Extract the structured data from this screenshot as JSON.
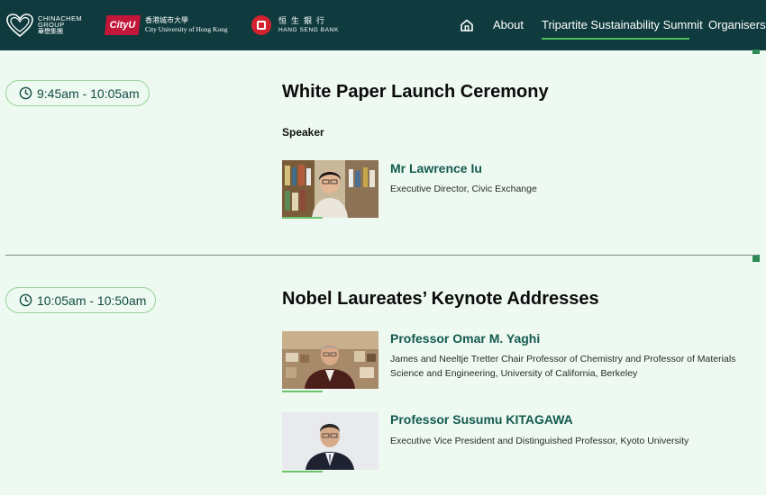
{
  "header": {
    "logos": {
      "chinachem": {
        "line1": "CHINACHEM",
        "line2": "GROUP",
        "line3": "華懋集團"
      },
      "cityu": {
        "badge": "CityU",
        "line1": "香港城市大學",
        "line2": "City University of Hong Kong"
      },
      "hangseng": {
        "line1": "恒生銀行",
        "line2": "HANG SENG BANK"
      }
    },
    "nav": {
      "home_icon": "home-icon",
      "items": [
        {
          "label": "About"
        },
        {
          "label": "Tripartite Sustainability Summit",
          "active": true
        },
        {
          "label": "Organisers"
        }
      ]
    }
  },
  "colors": {
    "header_bg": "#0f3b3e",
    "page_bg": "#eef9f1",
    "accent_green": "#4cbf5c",
    "name_teal": "#135a4e"
  },
  "sessions": [
    {
      "time": "9:45am - 10:05am",
      "title": "White Paper Launch Ceremony",
      "speaker_label": "Speaker",
      "speakers": [
        {
          "name": "Mr Lawrence Iu",
          "role": "Executive Director, Civic Exchange"
        }
      ]
    },
    {
      "time": "10:05am - 10:50am",
      "title": "Nobel Laureates’ Keynote Addresses",
      "speakers": [
        {
          "name": "Professor Omar M. Yaghi",
          "role": "James and Neeltje Tretter Chair Professor of Chemistry and Professor of Materials Science and Engineering, University of California, Berkeley"
        },
        {
          "name": "Professor Susumu KITAGAWA",
          "role": "Executive Vice President and Distinguished Professor, Kyoto University"
        }
      ]
    }
  ]
}
